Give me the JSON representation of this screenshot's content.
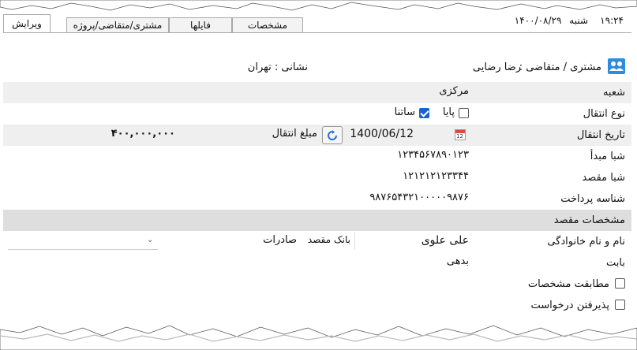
{
  "status": {
    "time": "۱۹:۲۴",
    "weekday": "شنبه",
    "date": "۱۴۰۰/۰۸/۲۹"
  },
  "tabs": [
    {
      "label": "ویرایش",
      "active": true
    },
    {
      "label": "مشتری/متقاضی/پروژه",
      "active": false
    },
    {
      "label": "فایلها",
      "active": false
    },
    {
      "label": "مشخصات",
      "active": false
    }
  ],
  "header": {
    "customer_label": "مشتری / متقاضی :",
    "customer_name": "رضا رضایی",
    "address": "نشانی : تهران"
  },
  "form": {
    "branch_label": "شعبه",
    "branch_value": "مرکزی",
    "transfer_type_label": "نوع انتقال",
    "paya_label": "پایا",
    "paya_checked": false,
    "satna_label": "ساتنا",
    "satna_checked": true,
    "transfer_date_label": "تاریخ انتقال",
    "transfer_date_value": "1400/06/12",
    "calendar_day": "12",
    "amount_label": "مبلغ انتقال",
    "amount_value": "۴۰۰,۰۰۰,۰۰۰",
    "source_sheba_label": "شبا مبدأ",
    "source_sheba_value": "۱۲۳۴۵۶۷۸۹۰۱۲۳",
    "dest_sheba_label": "شبا مقصد",
    "dest_sheba_value": "۱۲۱۲۱۲۱۲۳۳۴۴",
    "payment_id_label": "شناسه پرداخت",
    "payment_id_value": "۹۸۷۶۵۴۳۲۱۰۰۰۰۰۹۸۷۶",
    "dest_section_label": "مشخصات مقصد",
    "fullname_label": "نام و نام خانوادگی",
    "fullname_value": "علی علوی",
    "dest_bank_label": "بانک مقصد",
    "dest_bank_value": "صادرات",
    "reason_label": "بابت",
    "reason_value": "بدهی",
    "match_label": "مطابقت مشخصات",
    "match_checked": false,
    "accept_label": "پذیرفتن درخواست",
    "accept_checked": false
  },
  "colors": {
    "shade_row": "#efefef",
    "section_row": "#dedede",
    "checkbox_checked": "#1a63c9",
    "customer_icon": "#2d8be0"
  }
}
